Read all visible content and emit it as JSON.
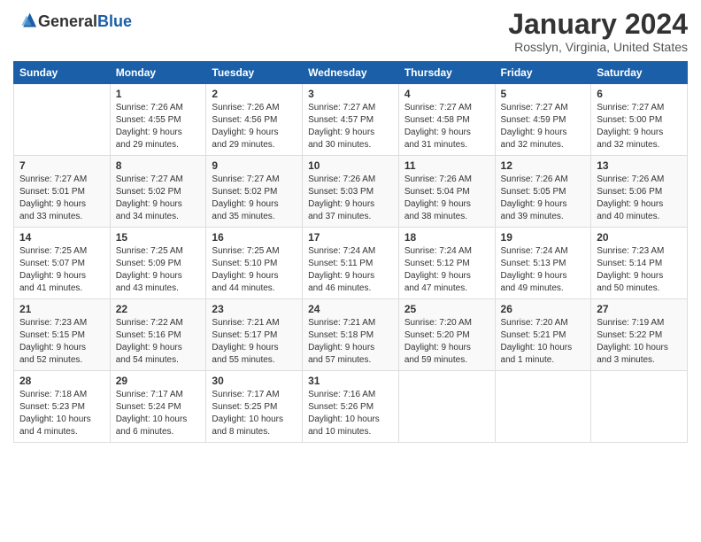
{
  "header": {
    "logo_general": "General",
    "logo_blue": "Blue",
    "month_year": "January 2024",
    "location": "Rosslyn, Virginia, United States"
  },
  "days_of_week": [
    "Sunday",
    "Monday",
    "Tuesday",
    "Wednesday",
    "Thursday",
    "Friday",
    "Saturday"
  ],
  "weeks": [
    [
      {
        "day": "",
        "info": ""
      },
      {
        "day": "1",
        "info": "Sunrise: 7:26 AM\nSunset: 4:55 PM\nDaylight: 9 hours\nand 29 minutes."
      },
      {
        "day": "2",
        "info": "Sunrise: 7:26 AM\nSunset: 4:56 PM\nDaylight: 9 hours\nand 29 minutes."
      },
      {
        "day": "3",
        "info": "Sunrise: 7:27 AM\nSunset: 4:57 PM\nDaylight: 9 hours\nand 30 minutes."
      },
      {
        "day": "4",
        "info": "Sunrise: 7:27 AM\nSunset: 4:58 PM\nDaylight: 9 hours\nand 31 minutes."
      },
      {
        "day": "5",
        "info": "Sunrise: 7:27 AM\nSunset: 4:59 PM\nDaylight: 9 hours\nand 32 minutes."
      },
      {
        "day": "6",
        "info": "Sunrise: 7:27 AM\nSunset: 5:00 PM\nDaylight: 9 hours\nand 32 minutes."
      }
    ],
    [
      {
        "day": "7",
        "info": "Sunrise: 7:27 AM\nSunset: 5:01 PM\nDaylight: 9 hours\nand 33 minutes."
      },
      {
        "day": "8",
        "info": "Sunrise: 7:27 AM\nSunset: 5:02 PM\nDaylight: 9 hours\nand 34 minutes."
      },
      {
        "day": "9",
        "info": "Sunrise: 7:27 AM\nSunset: 5:02 PM\nDaylight: 9 hours\nand 35 minutes."
      },
      {
        "day": "10",
        "info": "Sunrise: 7:26 AM\nSunset: 5:03 PM\nDaylight: 9 hours\nand 37 minutes."
      },
      {
        "day": "11",
        "info": "Sunrise: 7:26 AM\nSunset: 5:04 PM\nDaylight: 9 hours\nand 38 minutes."
      },
      {
        "day": "12",
        "info": "Sunrise: 7:26 AM\nSunset: 5:05 PM\nDaylight: 9 hours\nand 39 minutes."
      },
      {
        "day": "13",
        "info": "Sunrise: 7:26 AM\nSunset: 5:06 PM\nDaylight: 9 hours\nand 40 minutes."
      }
    ],
    [
      {
        "day": "14",
        "info": "Sunrise: 7:25 AM\nSunset: 5:07 PM\nDaylight: 9 hours\nand 41 minutes."
      },
      {
        "day": "15",
        "info": "Sunrise: 7:25 AM\nSunset: 5:09 PM\nDaylight: 9 hours\nand 43 minutes."
      },
      {
        "day": "16",
        "info": "Sunrise: 7:25 AM\nSunset: 5:10 PM\nDaylight: 9 hours\nand 44 minutes."
      },
      {
        "day": "17",
        "info": "Sunrise: 7:24 AM\nSunset: 5:11 PM\nDaylight: 9 hours\nand 46 minutes."
      },
      {
        "day": "18",
        "info": "Sunrise: 7:24 AM\nSunset: 5:12 PM\nDaylight: 9 hours\nand 47 minutes."
      },
      {
        "day": "19",
        "info": "Sunrise: 7:24 AM\nSunset: 5:13 PM\nDaylight: 9 hours\nand 49 minutes."
      },
      {
        "day": "20",
        "info": "Sunrise: 7:23 AM\nSunset: 5:14 PM\nDaylight: 9 hours\nand 50 minutes."
      }
    ],
    [
      {
        "day": "21",
        "info": "Sunrise: 7:23 AM\nSunset: 5:15 PM\nDaylight: 9 hours\nand 52 minutes."
      },
      {
        "day": "22",
        "info": "Sunrise: 7:22 AM\nSunset: 5:16 PM\nDaylight: 9 hours\nand 54 minutes."
      },
      {
        "day": "23",
        "info": "Sunrise: 7:21 AM\nSunset: 5:17 PM\nDaylight: 9 hours\nand 55 minutes."
      },
      {
        "day": "24",
        "info": "Sunrise: 7:21 AM\nSunset: 5:18 PM\nDaylight: 9 hours\nand 57 minutes."
      },
      {
        "day": "25",
        "info": "Sunrise: 7:20 AM\nSunset: 5:20 PM\nDaylight: 9 hours\nand 59 minutes."
      },
      {
        "day": "26",
        "info": "Sunrise: 7:20 AM\nSunset: 5:21 PM\nDaylight: 10 hours\nand 1 minute."
      },
      {
        "day": "27",
        "info": "Sunrise: 7:19 AM\nSunset: 5:22 PM\nDaylight: 10 hours\nand 3 minutes."
      }
    ],
    [
      {
        "day": "28",
        "info": "Sunrise: 7:18 AM\nSunset: 5:23 PM\nDaylight: 10 hours\nand 4 minutes."
      },
      {
        "day": "29",
        "info": "Sunrise: 7:17 AM\nSunset: 5:24 PM\nDaylight: 10 hours\nand 6 minutes."
      },
      {
        "day": "30",
        "info": "Sunrise: 7:17 AM\nSunset: 5:25 PM\nDaylight: 10 hours\nand 8 minutes."
      },
      {
        "day": "31",
        "info": "Sunrise: 7:16 AM\nSunset: 5:26 PM\nDaylight: 10 hours\nand 10 minutes."
      },
      {
        "day": "",
        "info": ""
      },
      {
        "day": "",
        "info": ""
      },
      {
        "day": "",
        "info": ""
      }
    ]
  ]
}
